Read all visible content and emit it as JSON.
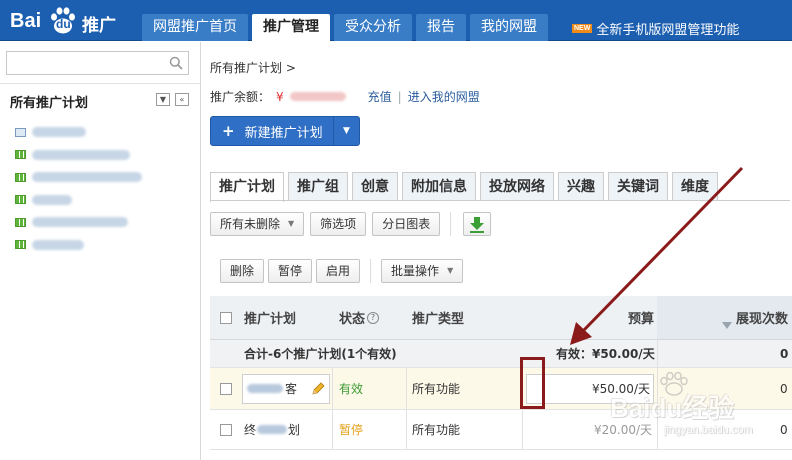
{
  "logo": {
    "text_bai": "Bai",
    "text_du": "du",
    "text_tuiguang": "推广"
  },
  "nav": {
    "tabs": [
      "网盟推广首页",
      "推广管理",
      "受众分析",
      "报告",
      "我的网盟"
    ],
    "active_tab": "推广管理",
    "promo_badge": "NEW",
    "promo_text": "全新手机版网盟管理功能"
  },
  "sidebar": {
    "search_placeholder": "",
    "title": "所有推广计划",
    "plan_count": 6
  },
  "main": {
    "breadcrumb": "所有推广计划 >",
    "balance_label": "推广余额：",
    "balance_currency": "¥",
    "recharge_link": "充值",
    "separator": "|",
    "enter_link": "进入我的网盟",
    "new_plan_button": "新建推广计划",
    "new_plan_plus": "+",
    "subtabs": [
      "推广计划",
      "推广组",
      "创意",
      "附加信息",
      "投放网络",
      "兴趣",
      "关键词",
      "维度"
    ],
    "filter_dropdown": "所有未删除",
    "filter_button": "筛选项",
    "daily_chart_button": "分日图表",
    "delete_button": "删除",
    "pause_button": "暂停",
    "enable_button": "启用",
    "batch_dropdown": "批量操作"
  },
  "table": {
    "headers": {
      "plan": "推广计划",
      "status": "状态",
      "status_help": "?",
      "type": "推广类型",
      "budget": "预算",
      "impressions": "展现次数"
    },
    "total": {
      "label": "合计-6个推广计划(1个有效)",
      "budget": "有效：¥50.00/天",
      "impressions": "0"
    },
    "rows": [
      {
        "plan_suffix": "客",
        "status": "有效",
        "type": "所有功能",
        "budget": "¥50.00/天",
        "impressions": "0"
      },
      {
        "plan_prefix": "终",
        "plan_suffix": "划",
        "status": "暂停",
        "type": "所有功能",
        "budget": "¥20.00/天",
        "impressions": "0"
      }
    ]
  },
  "watermark": {
    "line1": "Baidu经验",
    "line2": "jingyan.baidu.com"
  },
  "colors": {
    "topbar": "#1c5fb0",
    "accent_button": "#2f6fc5",
    "annotation": "#8b1a1a",
    "status_ok": "#3b9b33",
    "status_pause": "#e3a21a"
  }
}
